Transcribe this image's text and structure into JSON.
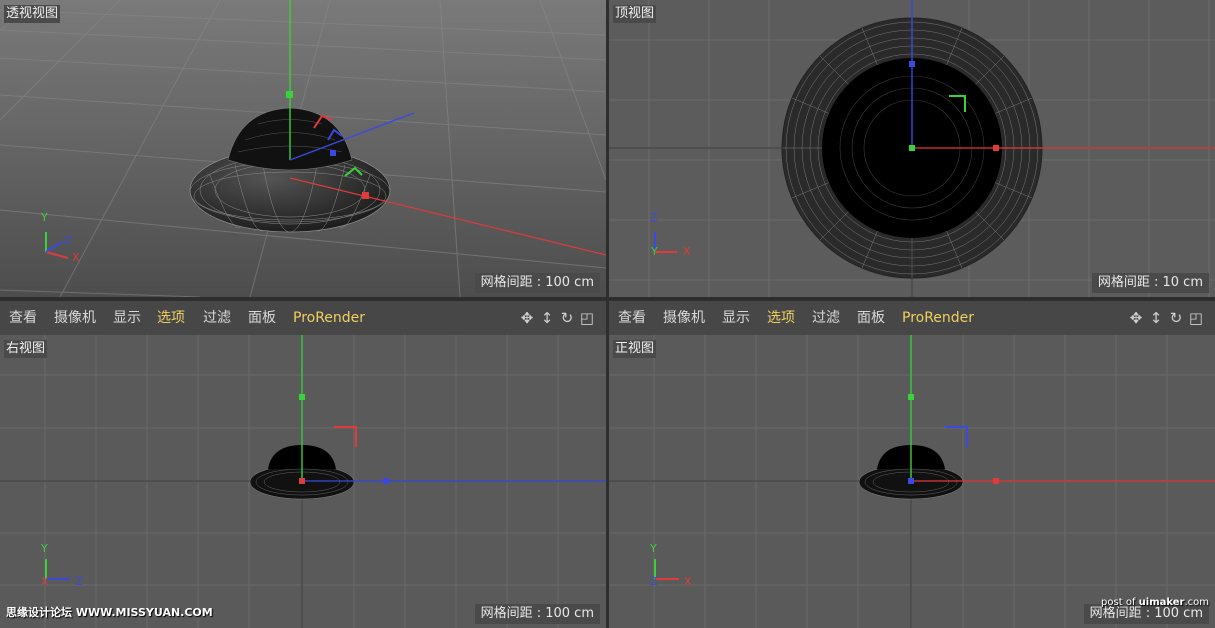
{
  "viewports": {
    "perspective": {
      "label": "透视视图",
      "grid_spacing": "网格间距 : 100 cm"
    },
    "top": {
      "label": "顶视图",
      "grid_spacing": "网格间距 : 10 cm"
    },
    "right": {
      "label": "右视图",
      "grid_spacing": "网格间距 : 100 cm"
    },
    "front": {
      "label": "正视图",
      "grid_spacing": "网格间距 : 100 cm"
    }
  },
  "menu": {
    "items": [
      "查看",
      "摄像机",
      "显示",
      "选项",
      "过滤",
      "面板",
      "ProRender"
    ],
    "active_item": "选项"
  },
  "menu_icons": [
    "move-view-icon",
    "dolly-view-icon",
    "rotate-view-icon",
    "maximize-view-icon"
  ],
  "axes": {
    "x": "X",
    "y": "Y",
    "z": "Z",
    "colors": {
      "x": "#e03a3a",
      "y": "#3ad13a",
      "z": "#3a4ae0"
    }
  },
  "watermarks": {
    "left": "思缘设计论坛 WWW.MISSYUAN.COM",
    "right_prefix": "post of ",
    "right_brand": "uimaker",
    "right_suffix": ".com"
  }
}
